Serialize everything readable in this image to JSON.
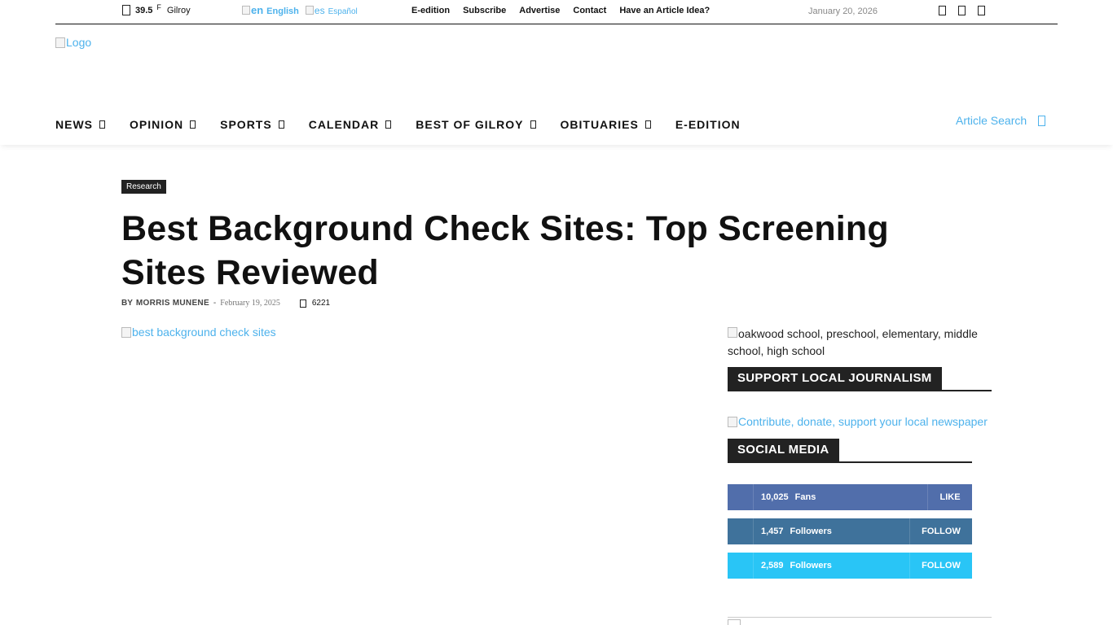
{
  "topbar": {
    "weather": {
      "temp": "39.5",
      "unit": "F",
      "city": "Gilroy"
    },
    "languages": [
      {
        "code": "en",
        "label": "English"
      },
      {
        "code": "es",
        "label": "Español"
      }
    ],
    "links": [
      "E-edition",
      "Subscribe",
      "Advertise",
      "Contact",
      "Have an Article Idea?"
    ],
    "date": "January 20, 2026",
    "social_icons": [
      "facebook-icon",
      "instagram-icon",
      "twitter-icon"
    ]
  },
  "header": {
    "logo_alt": "Logo"
  },
  "nav": {
    "items": [
      "NEWS",
      "OPINION",
      "SPORTS",
      "CALENDAR",
      "BEST OF GILROY",
      "OBITUARIES",
      "E-EDITION"
    ],
    "search_label": "Article Search"
  },
  "article": {
    "category": "Research",
    "title": "Best Background Check Sites: Top Screening Sites Reviewed",
    "by": "BY",
    "author": "MORRIS MUNENE",
    "date": "February 19, 2025",
    "views": "6221",
    "featured_image_alt": "best background check sites"
  },
  "sidebar": {
    "ad_alt": "oakwood school, preschool, elementary, middle school, high school",
    "support_heading": "SUPPORT LOCAL JOURNALISM",
    "contribute_alt": "Contribute, donate, support your local newspaper",
    "social_heading": "SOCIAL MEDIA",
    "social": [
      {
        "network": "facebook",
        "count": "10,025",
        "label": "Fans",
        "action": "LIKE",
        "color": "#516eab"
      },
      {
        "network": "twitter",
        "count": "1,457",
        "label": "Followers",
        "action": "FOLLOW",
        "color": "#3f729b"
      },
      {
        "network": "twitter",
        "count": "2,589",
        "label": "Followers",
        "action": "FOLLOW",
        "color": "#29c5f6"
      }
    ]
  },
  "colors": {
    "accent": "#4db2ec",
    "dark": "#222222"
  }
}
